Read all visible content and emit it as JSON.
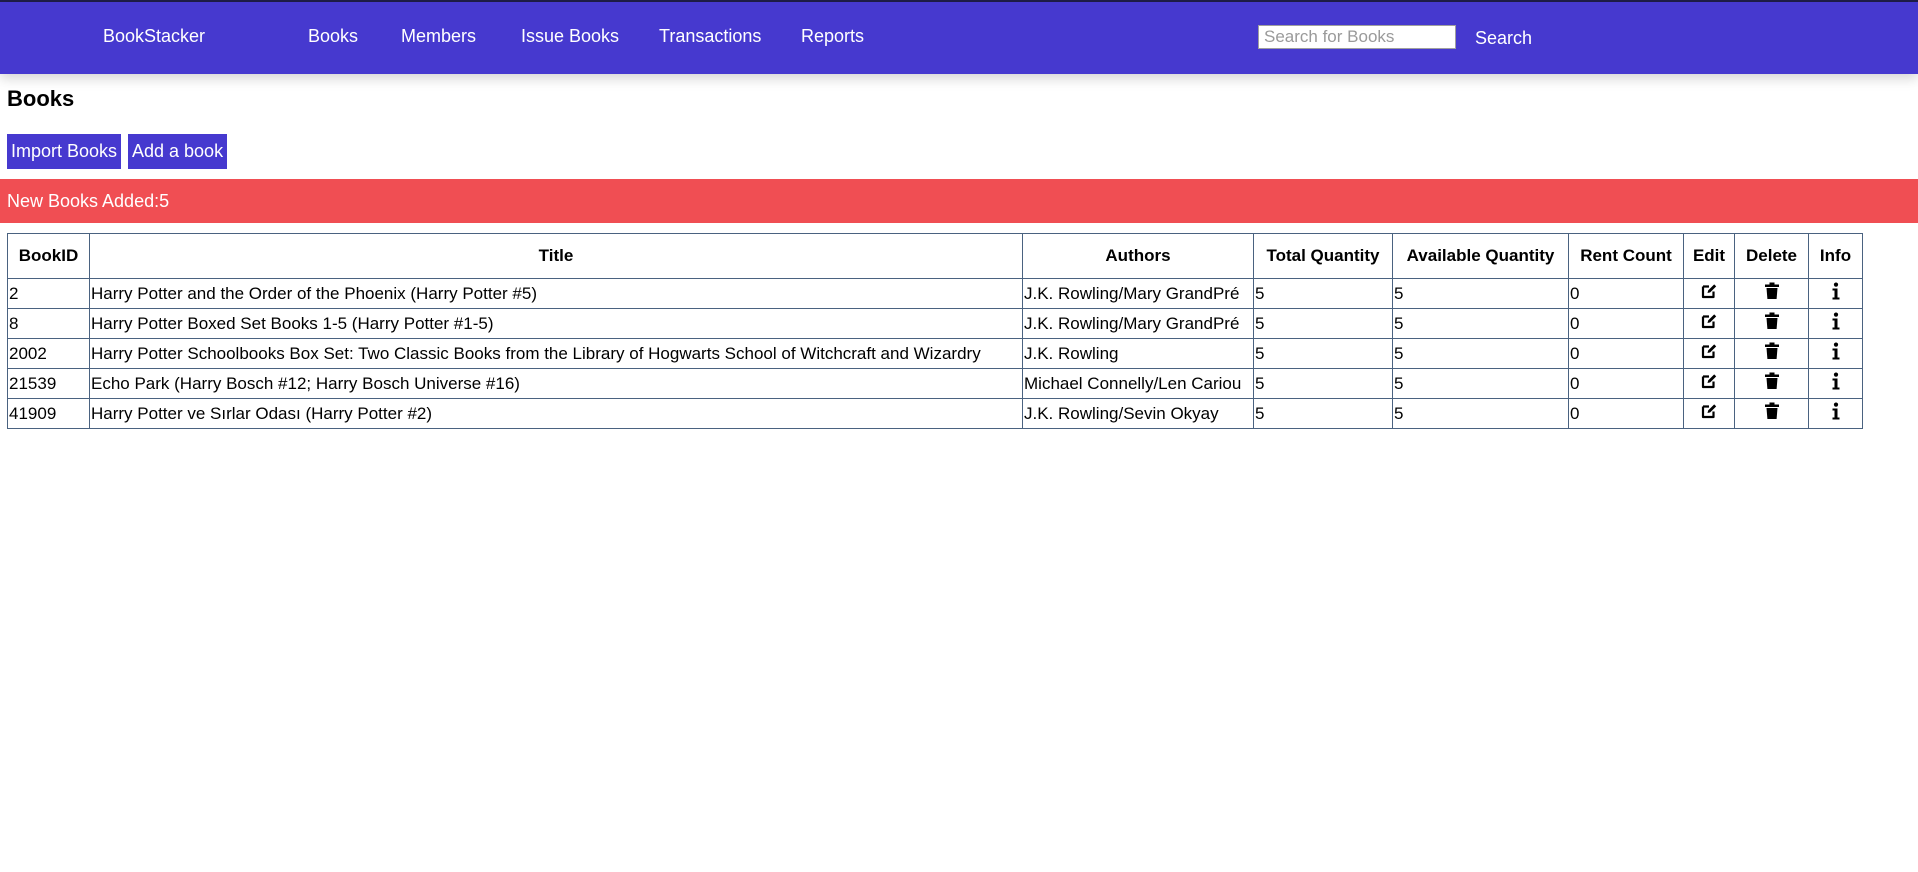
{
  "navbar": {
    "brand": "BookStacker",
    "links": [
      "Books",
      "Members",
      "Issue Books",
      "Transactions",
      "Reports"
    ],
    "search_placeholder": "Search for Books",
    "search_button": "Search"
  },
  "page": {
    "title": "Books",
    "import_button": "Import Books",
    "add_button": "Add a book",
    "alert": "New Books Added:5"
  },
  "table": {
    "headers": [
      "BookID",
      "Title",
      "Authors",
      "Total Quantity",
      "Available Quantity",
      "Rent Count",
      "Edit",
      "Delete",
      "Info"
    ],
    "rows": [
      {
        "id": "2",
        "title": "Harry Potter and the Order of the Phoenix (Harry Potter #5)",
        "authors": "J.K. Rowling/Mary GrandPré",
        "total": "5",
        "available": "5",
        "rent": "0"
      },
      {
        "id": "8",
        "title": "Harry Potter Boxed Set Books 1-5 (Harry Potter #1-5)",
        "authors": "J.K. Rowling/Mary GrandPré",
        "total": "5",
        "available": "5",
        "rent": "0"
      },
      {
        "id": "2002",
        "title": "Harry Potter Schoolbooks Box Set: Two Classic Books from the Library of Hogwarts School of Witchcraft and Wizardry",
        "authors": "J.K. Rowling",
        "total": "5",
        "available": "5",
        "rent": "0"
      },
      {
        "id": "21539",
        "title": "Echo Park (Harry Bosch #12; Harry Bosch Universe #16)",
        "authors": "Michael Connelly/Len Cariou",
        "total": "5",
        "available": "5",
        "rent": "0"
      },
      {
        "id": "41909",
        "title": "Harry Potter ve Sırlar Odası (Harry Potter #2)",
        "authors": "J.K. Rowling/Sevin Okyay",
        "total": "5",
        "available": "5",
        "rent": "0"
      }
    ],
    "row_icons": [
      "edit-icon",
      "trash-icon",
      "info-icon"
    ]
  },
  "colors": {
    "navbar": "#4639cf",
    "button": "#4639cf",
    "alert": "#f04e53",
    "table_border": "#4a6280"
  }
}
